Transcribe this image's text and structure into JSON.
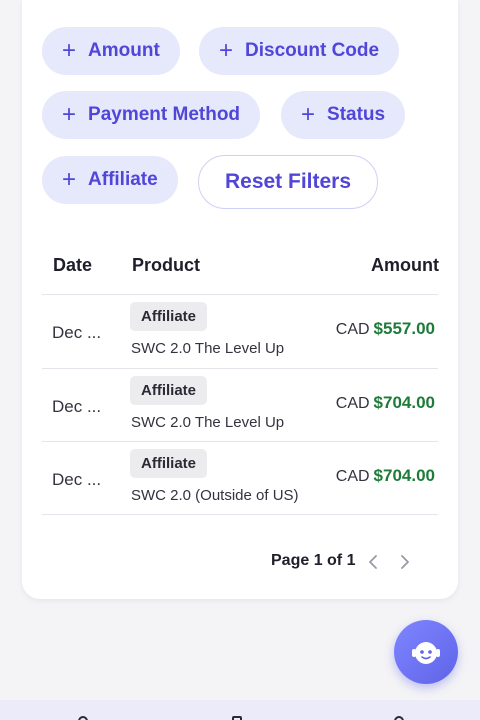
{
  "filters": {
    "chips": [
      {
        "plus": "+",
        "label": "Amount"
      },
      {
        "plus": "+",
        "label": "Discount Code"
      },
      {
        "plus": "+",
        "label": "Payment Method"
      },
      {
        "plus": "+",
        "label": "Status"
      },
      {
        "plus": "+",
        "label": "Affiliate"
      }
    ],
    "reset_label": "Reset Filters"
  },
  "table": {
    "headers": {
      "date": "Date",
      "product": "Product",
      "amount": "Amount"
    },
    "rows": [
      {
        "date": "Dec ...",
        "badge": "Affiliate",
        "product": "SWC 2.0 The Level Up",
        "currency": "CAD",
        "amount": "$557.00"
      },
      {
        "date": "Dec ...",
        "badge": "Affiliate",
        "product": "SWC 2.0 The Level Up",
        "currency": "CAD",
        "amount": "$704.00"
      },
      {
        "date": "Dec ...",
        "badge": "Affiliate",
        "product": "SWC 2.0 (Outside of US)",
        "currency": "CAD",
        "amount": "$704.00"
      }
    ]
  },
  "pagination": {
    "label": "Page 1 of 1"
  },
  "icons": {
    "prev": "chevron-left-icon",
    "next": "chevron-right-icon",
    "assistant": "robot-face-icon"
  },
  "colors": {
    "accent": "#5146d8",
    "chip_bg": "#e6e8fb",
    "amount_green": "#1e7b3a",
    "assistant_button": "#6a6ff0"
  }
}
